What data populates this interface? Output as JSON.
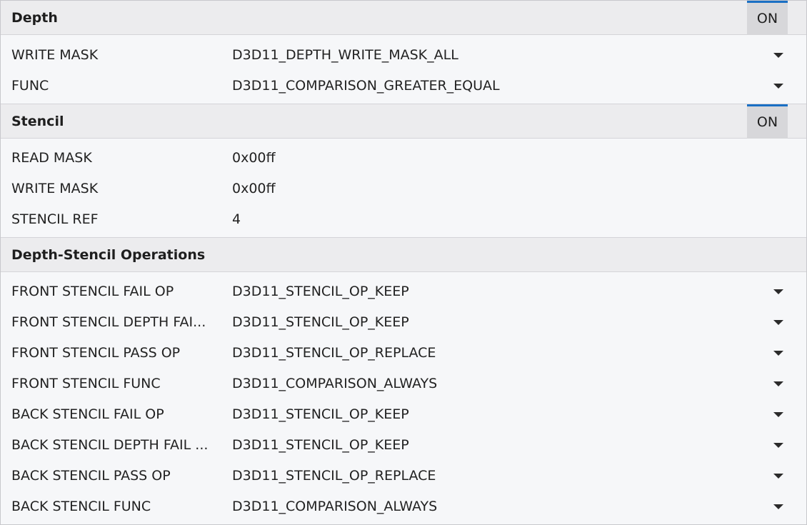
{
  "sections": {
    "depth": {
      "title": "Depth",
      "toggle": "ON",
      "rows": [
        {
          "label": "WRITE MASK",
          "value": "D3D11_DEPTH_WRITE_MASK_ALL"
        },
        {
          "label": "FUNC",
          "value": "D3D11_COMPARISON_GREATER_EQUAL"
        }
      ]
    },
    "stencil": {
      "title": "Stencil",
      "toggle": "ON",
      "rows": [
        {
          "label": "READ MASK",
          "value": "0x00ff"
        },
        {
          "label": "WRITE MASK",
          "value": "0x00ff"
        },
        {
          "label": "STENCIL REF",
          "value": "4"
        }
      ]
    },
    "operations": {
      "title": "Depth-Stencil Operations",
      "rows": [
        {
          "label": "FRONT STENCIL FAIL OP",
          "value": "D3D11_STENCIL_OP_KEEP"
        },
        {
          "label": "FRONT STENCIL DEPTH FAI...",
          "value": "D3D11_STENCIL_OP_KEEP"
        },
        {
          "label": "FRONT STENCIL PASS OP",
          "value": "D3D11_STENCIL_OP_REPLACE"
        },
        {
          "label": "FRONT STENCIL FUNC",
          "value": "D3D11_COMPARISON_ALWAYS"
        },
        {
          "label": "BACK STENCIL FAIL OP",
          "value": "D3D11_STENCIL_OP_KEEP"
        },
        {
          "label": "BACK STENCIL DEPTH FAIL ...",
          "value": "D3D11_STENCIL_OP_KEEP"
        },
        {
          "label": "BACK STENCIL PASS OP",
          "value": "D3D11_STENCIL_OP_REPLACE"
        },
        {
          "label": "BACK STENCIL FUNC",
          "value": "D3D11_COMPARISON_ALWAYS"
        }
      ]
    }
  },
  "colors": {
    "accent": "#1a6fc4",
    "header_bg": "#ececee",
    "panel_bg": "#f6f7f9",
    "toggle_bg": "#d7d7da"
  },
  "icons": {
    "dropdown": "chevron-down-icon"
  }
}
